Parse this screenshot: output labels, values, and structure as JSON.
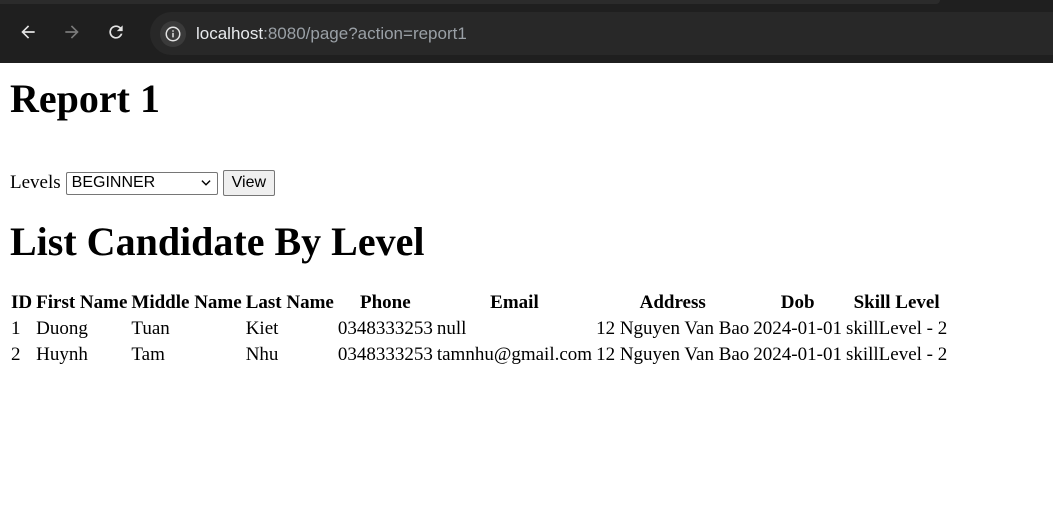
{
  "browser": {
    "url_host": "localhost",
    "url_rest": ":8080/page?action=report1",
    "back_icon": "arrow-left-icon",
    "forward_icon": "arrow-right-icon",
    "reload_icon": "reload-icon",
    "info_icon": "info-icon"
  },
  "page": {
    "title": "Report 1",
    "form": {
      "levels_label": "Levels",
      "selected_level": "BEGINNER",
      "view_button": "View"
    },
    "list_title": "List Candidate By Level",
    "table": {
      "headers": [
        "ID",
        "First Name",
        "Middle Name",
        "Last Name",
        "Phone",
        "Email",
        "Address",
        "Dob",
        "Skill Level"
      ],
      "rows": [
        [
          "1",
          "Duong",
          "Tuan",
          "Kiet",
          "0348333253",
          "null",
          "12 Nguyen Van Bao",
          "2024-01-01",
          "skillLevel - 2"
        ],
        [
          "2",
          "Huynh",
          "Tam",
          "Nhu",
          "0348333253",
          "tamnhu@gmail.com",
          "12 Nguyen Van Bao",
          "2024-01-01",
          "skillLevel - 2"
        ]
      ]
    }
  }
}
